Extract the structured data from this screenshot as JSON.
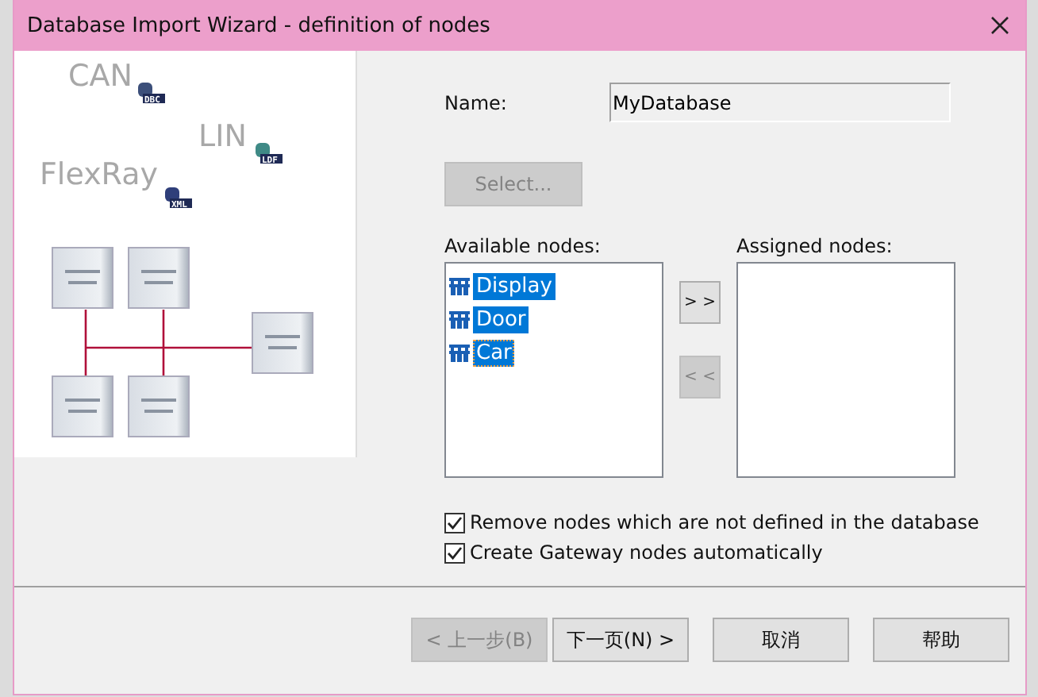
{
  "window": {
    "title": "Database Import Wizard - definition of nodes"
  },
  "illustration": {
    "bus_labels": [
      {
        "text": "CAN",
        "file": "DBC"
      },
      {
        "text": "LIN",
        "file": "LDF"
      },
      {
        "text": "FlexRay",
        "file": "XML"
      }
    ]
  },
  "name_field": {
    "label": "Name:",
    "value": "MyDatabase"
  },
  "select_button": {
    "label": "Select...",
    "disabled": true
  },
  "available_nodes": {
    "label": "Available nodes:",
    "items": [
      {
        "text": "Display",
        "selected": true,
        "focused": false
      },
      {
        "text": "Door",
        "selected": true,
        "focused": false
      },
      {
        "text": "Car",
        "selected": true,
        "focused": true
      }
    ]
  },
  "move_buttons": [
    {
      "label": "> >",
      "disabled": false
    },
    {
      "label": "< <",
      "disabled": true
    }
  ],
  "assigned_nodes": {
    "label": "Assigned nodes:"
  },
  "options": [
    {
      "label": "Remove nodes which are not defined in the database",
      "checked": true
    },
    {
      "label": "Create Gateway nodes automatically",
      "checked": true
    }
  ],
  "buttons": [
    {
      "label": "< 上一步(B)",
      "disabled": true
    },
    {
      "label": "下一页(N) >",
      "disabled": false
    },
    {
      "label": "取消",
      "disabled": false
    },
    {
      "label": "帮助",
      "disabled": false
    }
  ]
}
